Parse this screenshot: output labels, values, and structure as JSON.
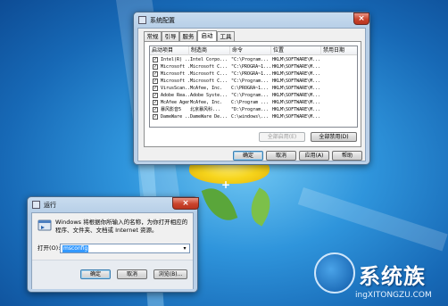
{
  "msconfig": {
    "title": "系统配置",
    "close_glyph": "×",
    "tabs": [
      "常规",
      "引导",
      "服务",
      "启动",
      "工具"
    ],
    "active_tab": "启动",
    "columns": [
      "启动项目",
      "制造商",
      "命令",
      "位置",
      "禁用日期"
    ],
    "rows": [
      [
        "Intel(R) ...",
        "Intel Corpo...",
        "\"C:\\Program...",
        "HKLM\\SOFTWARE\\M...",
        ""
      ],
      [
        "Microsoft ...",
        "Microsoft C...",
        "\"C:\\PROGRA~1...",
        "HKLM\\SOFTWARE\\M...",
        ""
      ],
      [
        "Microsoft ...",
        "Microsoft C...",
        "\"C:\\PROGRA~1...",
        "HKLM\\SOFTWARE\\M...",
        ""
      ],
      [
        "Microsoft ...",
        "Microsoft C...",
        "\"C:\\Program...",
        "HKLM\\SOFTWARE\\M...",
        ""
      ],
      [
        "VirusScan...",
        "McAfee, Inc.",
        "C:\\PROGRA~1...",
        "HKLM\\SOFTWARE\\M...",
        ""
      ],
      [
        "Adobe Rea...",
        "Adobe Syste...",
        "\"C:\\Program...",
        "HKLM\\SOFTWARE\\M...",
        ""
      ],
      [
        "McAfee Agent",
        "McAfee, Inc.",
        "C:\\Program ...",
        "HKLM\\SOFTWARE\\M...",
        ""
      ],
      [
        "暴风影音5",
        "北京暴风科...",
        "\"D:\\Program...",
        "HKLM\\SOFTWARE\\M...",
        ""
      ],
      [
        "DameWare ...",
        "DameWare De...",
        "C:\\windows\\...",
        "HKLM\\SOFTWARE\\M...",
        ""
      ]
    ],
    "first_row_cmd": "\"C:\\Program...",
    "enable_all": "全部启用(E)",
    "disable_all": "全部禁用(D)",
    "ok": "确定",
    "cancel": "取消",
    "apply": "应用(A)",
    "help": "帮助"
  },
  "run": {
    "title": "运行",
    "close_glyph": "×",
    "description": "Windows 将根据你所输入的名称，为你打开相应的程序、文件夹、文档或 Internet 资源。",
    "open_label": "打开(O):",
    "input_value": "msconfig",
    "dropdown_glyph": "▾",
    "ok": "确定",
    "cancel": "取消",
    "browse": "浏览(B)..."
  },
  "watermark": {
    "brand": "系统族",
    "url": "ingXITONGZU.COM"
  },
  "cursor_glyph": "+"
}
